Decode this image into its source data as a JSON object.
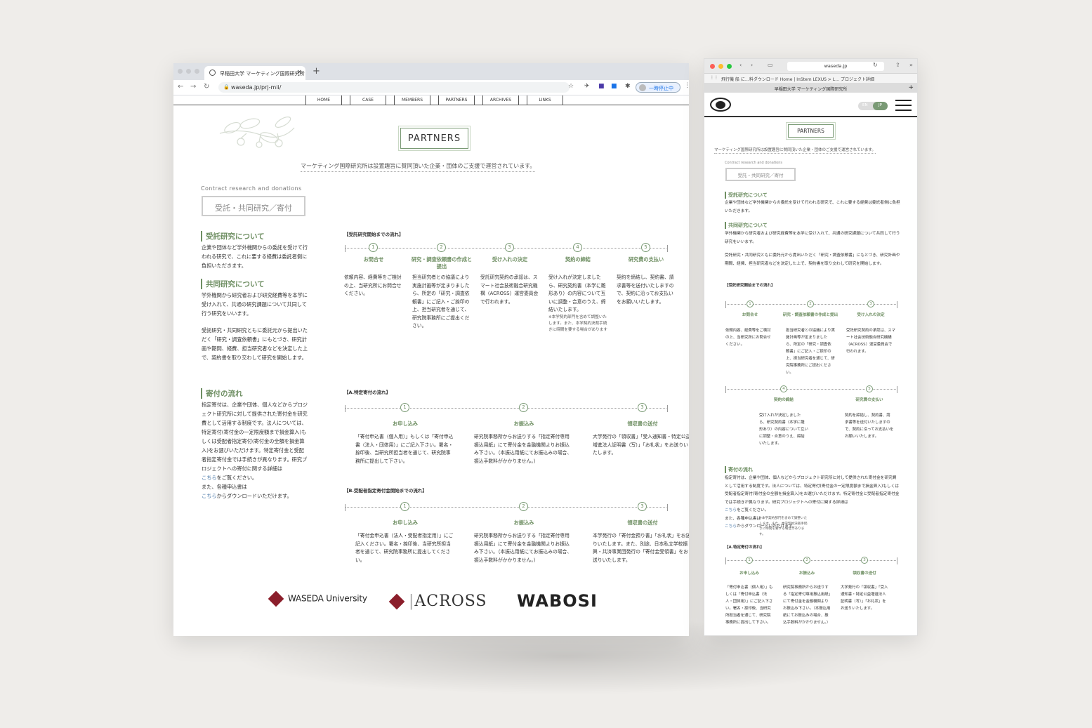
{
  "desktop": {
    "tab_title": "早稲田大学 マーケティング国際研究所",
    "url": "waseda.jp/prj-mii/",
    "pause_label": "一時停止中",
    "nav": [
      "HOME",
      "CASE",
      "MEMBERS",
      "PARTNERS",
      "ARCHIVES",
      "LINKS"
    ],
    "page_title": "PARTNERS",
    "intro": "マーケティング国際研究所は設置趣旨に賛同頂いた企業・団体のご支援で運営されています。",
    "contract_en": "Contract research and donations",
    "contract_jp": "受託・共同研究／寄付",
    "sec1_title": "受託研究について",
    "sec1_text": "企業や団体など学外機関からの委託を受けて行われる研究で、これに要する経費は委託者側に負担いただきます。",
    "sec2_title": "共同研究について",
    "sec2_text": "学外機関から研究者および研究経費等を本学に受け入れて、共通の研究課題について共同して行う研究をいいます。",
    "sec2_text2": "受託研究・共同研究ともに委託元から提出いただく「研究・調査依頼書」にもとづき、研究計画や期間、経費、担当研究者などを決定した上で、契約書を取り交わして研究を開始します。",
    "sec3_title": "寄付の流れ",
    "sec3_text": "指定寄付は、企業や団体、個人などからプロジェクト研究所に対して提供された寄付金を研究費として活用する制度です。法人については、特定寄付(寄付金の一定限度額まで損金算入)もしくは受配者指定寄付(寄付金の全額を損金算入)をお選びいただけます。特定寄付金と受配者指定寄付金では手続きが異なります。研究プロジェクトへの寄付に関する詳細は",
    "link1": "こちら",
    "link1_after": "をご覧ください。",
    "line_forms": "また、各種申込書は",
    "link2": "こちら",
    "link2_after": "からダウンロードいただけます。",
    "flow1_head": "【受託研究開始までの流れ】",
    "flow1": [
      {
        "n": "1",
        "title": "お問合せ",
        "text": "依頼内容、経費等をご検討の上、当研究所にお問合せください。"
      },
      {
        "n": "2",
        "title": "研究・調査依頼書の作成と提出",
        "text": "担当研究者との協議により実施計画等が定まりましたら、所定の「研究・調査依頼書」にご記入・ご捺印の上、担当研究者を通じて、研究院事務所にご提出ください。"
      },
      {
        "n": "3",
        "title": "受け入れの決定",
        "text": "受託研究契約の承認は、スマート社会技術融合研究機構（ACROSS）運営委員会で行われます。"
      },
      {
        "n": "4",
        "title": "契約の締結",
        "text": "受け入れが決定しましたら、研究契約書（本学に雛形あり）の内容について互いに調整・合意のうえ、締結いたします。",
        "note": "※本学契約部門を含めて調整いたします。また、本学契約決裁手続きに時間を要する場合があります"
      },
      {
        "n": "5",
        "title": "研究費の支払い",
        "text": "契約を締結し、契約書、請求書等を送付いたしますので、契約に沿ってお支払いをお願いいたします。"
      }
    ],
    "flowA_head": "【A.特定寄付の流れ】",
    "flowA": [
      {
        "n": "1",
        "title": "お申し込み",
        "text": "「寄付申込書（個人用）」もしくは「寄付申込書（法人・団体用）」にご記入下さい。署名・捺印後、当研究所担当者を通じて、研究院事務所に提出して下さい。"
      },
      {
        "n": "2",
        "title": "お振込み",
        "text": "研究院事務所からお送りする「指定寄付専用振込用紙」にて寄付金を金融機関よりお振込み下さい。（本振込用紙にてお振込みの場合、振込手数料がかかりません。）"
      },
      {
        "n": "3",
        "title": "領収書の送付",
        "text": "大学発行の「領収書」「受入通知書・特定公益増進法人証明書（写）」「お礼状」をお送りいたします。"
      }
    ],
    "flowB_head": "【B.受配者指定寄付金開始までの流れ】",
    "flowB": [
      {
        "n": "1",
        "title": "お申し込み",
        "text": "「寄付金申込書（法人・受配者指定用）」にご記入ください。署名・捺印後、当研究所担当者を通じて、研究院事務所に提出してください。"
      },
      {
        "n": "2",
        "title": "お振込み",
        "text": "研究院事務所からお送りする「指定寄付専用振込用紙」にて寄付金を金融機関よりお振込み下さい。（本振込用紙にてお振込みの場合、振込手数料がかかりません。）"
      },
      {
        "n": "3",
        "title": "領収書の送付",
        "text": "本学発行の「寄付金預り書」「お礼状」をお送りいたします。また、別途、日本私立学校振興・共済事業団発行の「寄付金受領書」をお送りいたします。"
      }
    ],
    "logos": [
      "WASEDA University",
      "ACROSS",
      "WABOSI"
    ]
  },
  "mobile": {
    "url": "waseda.jp",
    "bookmarks": "飛行機  船 に…料ダウンロード   Home | InStem   LEXUS > L… プロジェクト詳細",
    "tab_title": "早稲田大学 マーケティング国際研究所",
    "lang_en": "EN",
    "lang_jp": "JP",
    "page_title": "PARTNERS",
    "intro": "マーケティング国際研究所は設置趣旨に賛同頂いた企業・団体のご支援で運営されています。",
    "contract_en": "Contract research and donations",
    "contract_jp": "受託・共同研究／寄付",
    "sec1_title": "受託研究について",
    "sec1_text": "企業や団体など学外機関からの委託を受けて行われる研究で、これに要する経費は委託者側に負担いただきます。",
    "sec2_title": "共同研究について",
    "sec2_text": "学外機関から研究者および研究経費等を本学に受け入れて、共通の研究課題について共同して行う研究をいいます。",
    "sec2_text2": "受託研究・共同研究ともに委託元から提出いただく「研究・調査依頼書」にもとづき、研究計画や期間、経費、担当研究者などを決定した上で、契約書を取り交わして研究を開始します。",
    "flow1_head": "【受託研究開始までの流れ】",
    "flow1": [
      {
        "n": "1",
        "title": "お問合せ",
        "text": "依頼内容、経費等をご検討の上、当研究所にお問合せください。"
      },
      {
        "n": "2",
        "title": "研究・調査依頼書の作成と提出",
        "text": "担当研究者との協議により実施計画等が定まりましたら、所定の「研究・調査依頼書」にご記入・ご捺印の上、担当研究者を通じて、研究院事務所にご提出ください。"
      },
      {
        "n": "3",
        "title": "受け入れの決定",
        "text": "受託研究契約の承認は、スマート社会技術融合研究機構（ACROSS）運営委員会で行われます。"
      },
      {
        "n": "4",
        "title": "契約の締結",
        "text": "受け入れが決定しましたら、研究契約書（本学に雛形あり）の内容について互いに調整・合意のうえ、締結いたします。",
        "note": "※本学契約部門を含めて調整いたします。また、本学契約決裁手続きに時間を要する場合があります。"
      },
      {
        "n": "5",
        "title": "研究費の支払い",
        "text": "契約を締結し、契約書、請求書等を送付いたしますので、契約に沿ってお支払いをお願いいたします。"
      }
    ],
    "sec3_title": "寄付の流れ",
    "sec3_text": "指定寄付は、企業や団体、個人などからプロジェクト研究所に対して提供された寄付金を研究費として活用する制度です。法人については、特定寄付(寄付金の一定限度額まで損金算入)もしくは受配者指定寄付(寄付金の全額を損金算入)をお選びいただけます。特定寄付金と受配者指定寄付金では手続きが異なります。研究プロジェクトへの寄付に関する詳細は",
    "link1": "こちら",
    "link1_after": "をご覧ください。",
    "line_forms": "また、各種申込書は",
    "link2": "こちら",
    "link2_after": "からダウンロードいただけます。",
    "flowA_head": "【A.特定寄付の流れ】",
    "flowA": [
      {
        "n": "1",
        "title": "お申し込み",
        "text": "「寄付申込書（個人用）」もしくは「寄付申込書（法人・団体用）」にご記入下さい。署名・捺印後、当研究所担当者を通じて、研究院事務所に提出して下さい。"
      },
      {
        "n": "2",
        "title": "お振込み",
        "text": "研究院事務所からお送りする「指定寄付専用振込用紙」にて寄付金を金融機関よりお振込み下さい。（本振込用紙にてお振込みの場合、振込手数料がかかりません。）"
      },
      {
        "n": "3",
        "title": "領収書の送付",
        "text": "大学発行の「領収書」「受入通知書・特定公益増進法人証明書（写）」「お礼状」をお送りいたします。"
      }
    ]
  },
  "colors": {
    "accent_green": "#6f8f63",
    "link_blue": "#4a78a8",
    "waseda_red": "#8b1e2b"
  }
}
